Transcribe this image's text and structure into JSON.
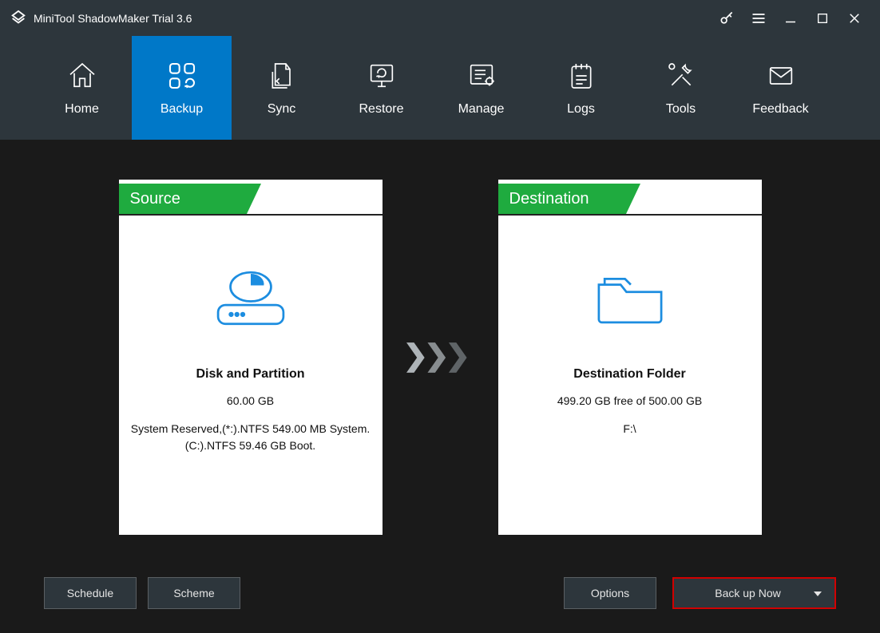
{
  "title": "MiniTool ShadowMaker Trial 3.6",
  "nav": {
    "home": "Home",
    "backup": "Backup",
    "sync": "Sync",
    "restore": "Restore",
    "manage": "Manage",
    "logs": "Logs",
    "tools": "Tools",
    "feedback": "Feedback"
  },
  "source": {
    "tab": "Source",
    "title": "Disk and Partition",
    "size": "60.00 GB",
    "detail": "System Reserved,(*:).NTFS 549.00 MB System. (C:).NTFS 59.46 GB Boot."
  },
  "destination": {
    "tab": "Destination",
    "title": "Destination Folder",
    "free": "499.20 GB free of 500.00 GB",
    "path": "F:\\"
  },
  "buttons": {
    "schedule": "Schedule",
    "scheme": "Scheme",
    "options": "Options",
    "backup_now": "Back up Now"
  }
}
